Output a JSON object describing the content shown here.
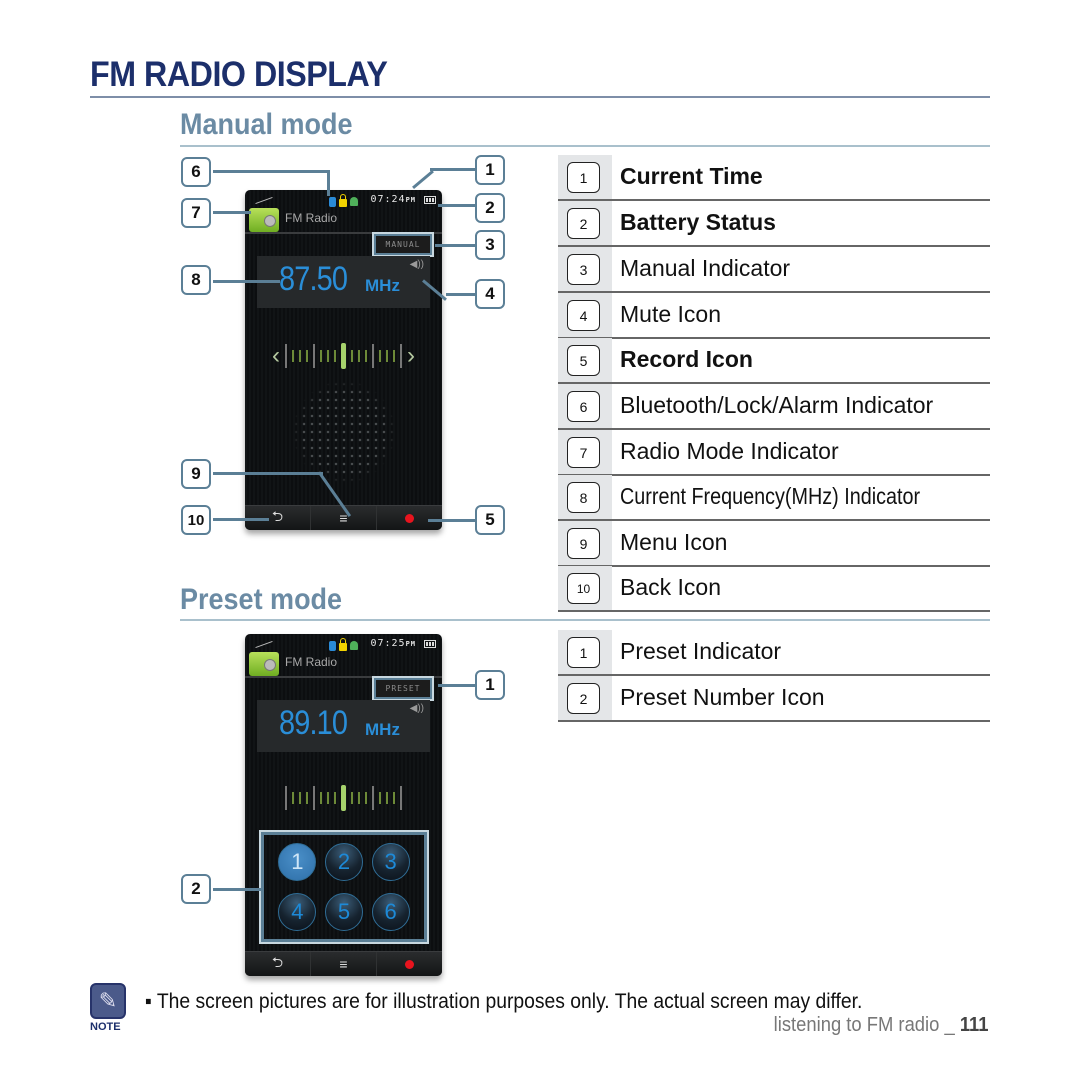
{
  "page_title": "FM RADIO DISPLAY",
  "sections": {
    "manual": {
      "heading": "Manual mode",
      "screen": {
        "time": "07:24",
        "ampm": "PM",
        "app_name": "FM Radio",
        "mode_badge": "MANUAL",
        "frequency": "87.50",
        "unit": "MHz",
        "bottom_bar": {
          "back": "⮌",
          "menu": "≡"
        }
      },
      "callouts": [
        "1",
        "2",
        "3",
        "4",
        "5",
        "6",
        "7",
        "8",
        "9",
        "10"
      ],
      "legend": [
        {
          "num": "1",
          "label": "Current Time"
        },
        {
          "num": "2",
          "label": "Battery Status"
        },
        {
          "num": "3",
          "label": "Manual Indicator"
        },
        {
          "num": "4",
          "label": "Mute Icon"
        },
        {
          "num": "5",
          "label": "Record Icon"
        },
        {
          "num": "6",
          "label": "Bluetooth/Lock/Alarm Indicator"
        },
        {
          "num": "7",
          "label": "Radio Mode Indicator"
        },
        {
          "num": "8",
          "label": "Current Frequency(MHz) Indicator"
        },
        {
          "num": "9",
          "label": "Menu Icon"
        },
        {
          "num": "10",
          "label": "Back Icon"
        }
      ]
    },
    "preset": {
      "heading": "Preset mode",
      "screen": {
        "time": "07:25",
        "ampm": "PM",
        "app_name": "FM Radio",
        "mode_badge": "PRESET",
        "frequency": "89.10",
        "unit": "MHz",
        "presets": [
          "1",
          "2",
          "3",
          "4",
          "5",
          "6"
        ],
        "active_preset": "1",
        "bottom_bar": {
          "back": "⮌",
          "menu": "≡"
        }
      },
      "callouts": [
        "1",
        "2"
      ],
      "legend": [
        {
          "num": "1",
          "label": "Preset Indicator"
        },
        {
          "num": "2",
          "label": "Preset Number Icon"
        }
      ]
    }
  },
  "note": {
    "label": "NOTE",
    "text": "▪ The screen pictures are for illustration purposes only. The actual screen may differ."
  },
  "footer": {
    "section": "listening to FM radio _ ",
    "page_number": "111"
  },
  "colors": {
    "title": "#1c2f6b",
    "subheading": "#6b8ba4",
    "callout_border": "#5b7f96",
    "frequency": "#2a8ed8",
    "record": "#e8141e"
  }
}
